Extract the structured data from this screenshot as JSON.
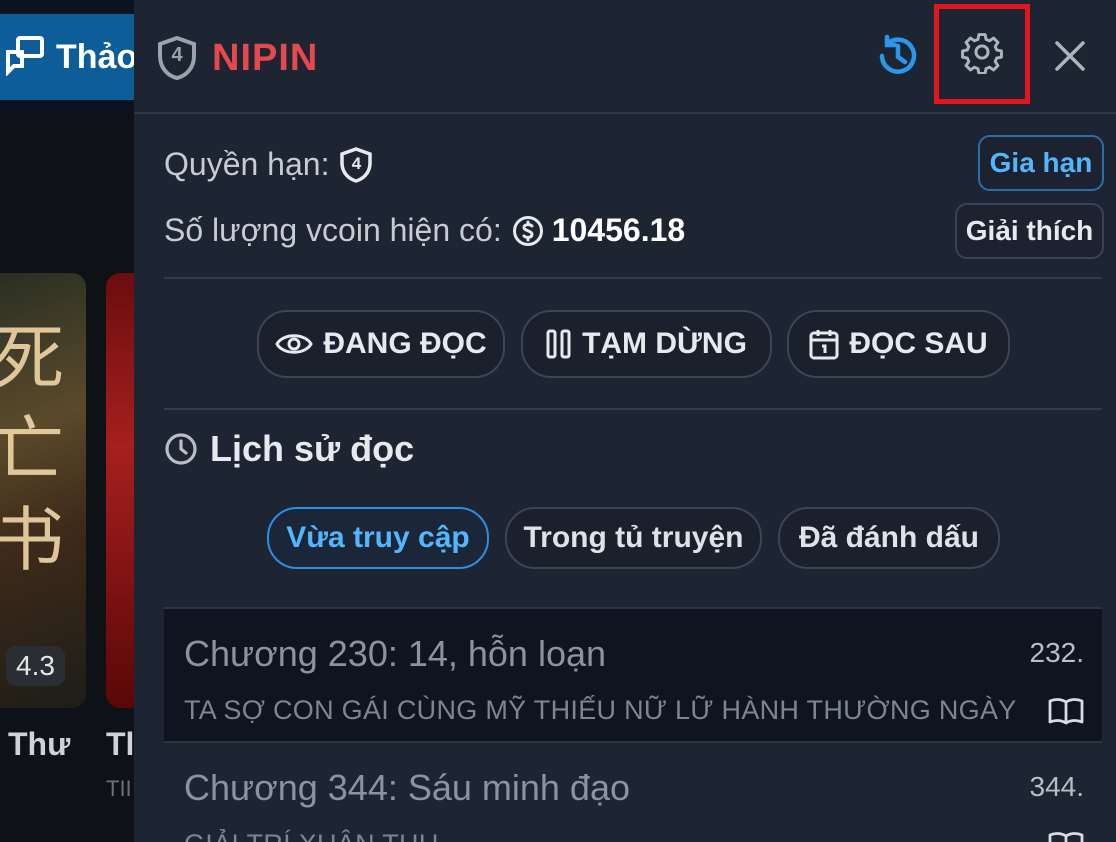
{
  "background": {
    "topbar_button_label": "Thảo",
    "card1": {
      "rating": "4.3",
      "title": "Thư",
      "glyph_text": "死\n亡\n书"
    },
    "card2": {
      "title": "Tl",
      "subtitle": "TII"
    }
  },
  "panel": {
    "brand": {
      "level": "4",
      "name": "NIPIN"
    },
    "header_buttons": {
      "history": "history-icon",
      "settings": "gear-icon",
      "close": "close-icon"
    },
    "permission": {
      "label": "Quyền hạn:",
      "level": "4",
      "renew_button": "Gia hạn"
    },
    "vcoin": {
      "label": "Số lượng vcoin hiện có:",
      "amount": "10456.18",
      "explain_button": "Giải thích"
    },
    "status_buttons": [
      {
        "label": "ĐANG ĐỌC",
        "icon": "eye-icon"
      },
      {
        "label": "TẠM DỪNG",
        "icon": "pause-icon"
      },
      {
        "label": "ĐỌC SAU",
        "icon": "calendar-icon"
      }
    ],
    "history": {
      "title": "Lịch sử đọc",
      "tabs": [
        {
          "label": "Vừa truy cập",
          "active": true
        },
        {
          "label": "Trong tủ truyện",
          "active": false
        },
        {
          "label": "Đã đánh dấu",
          "active": false
        }
      ],
      "items": [
        {
          "chapter": "Chương 230: 14, hỗn loạn",
          "number": "232.",
          "story": "TA SỢ CON GÁI CÙNG MỸ THIẾU NỮ LỮ HÀNH THƯỜNG NGÀY"
        },
        {
          "chapter": "Chương 344: Sáu minh đạo",
          "number": "344.",
          "story": "GIẢI TRÍ XUÂN THU"
        }
      ]
    }
  },
  "colors": {
    "accent": "#52b6ff",
    "brand": "#e5484d",
    "highlight": "#e2161c",
    "panel_bg": "#1e2532"
  }
}
